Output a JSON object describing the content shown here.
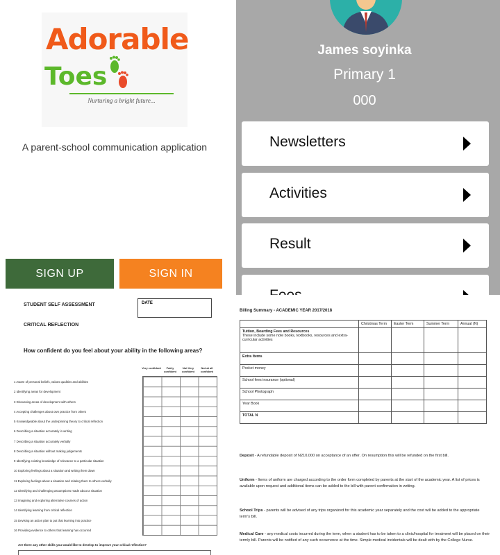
{
  "landing": {
    "logo_line1": "Adorable",
    "logo_line2": "Toes",
    "logo_tagline": "Nurturing a bright future...",
    "description": "A parent-school communication application",
    "signup_label": "SIGN UP",
    "signin_label": "SIGN IN",
    "colors": {
      "orange": "#f05a1a",
      "green": "#5cb82b",
      "signup_bg": "#3e6a3a",
      "signin_bg": "#f58220"
    }
  },
  "profile": {
    "name": "James soyinka",
    "class": "Primary 1",
    "id": "000",
    "menu": [
      "Newsletters",
      "Activities",
      "Result",
      "Fees"
    ],
    "colors": {
      "background": "#a8a8a8",
      "avatar_bg": "#2cb0a8"
    }
  },
  "assessment": {
    "title": "STUDENT SELF ASSESSMENT",
    "date_label": "DATE",
    "section": "CRITICAL REFLECTION",
    "question": "How confident do you feel about your ability in the following areas?",
    "columns": [
      "Very confident",
      "Fairly confident",
      "Not Very confident",
      "Not at all confident"
    ],
    "items": [
      "1  Aware of personal beliefs, values qualities and abilities",
      "2  Identifying areas for development",
      "3  Discussing areas of development with others",
      "4  Accepting challenges about own practice from others",
      "5  Knowledgeable about the underpinning theory to critical reflection",
      "6  Describing a situation accurately in writing",
      "7  Describing a situation accurately verbally",
      "8  Describing a situation without making judgements",
      "9  Identifying existing knowledge of relevance to a particular situation",
      "10 Exploring feelings about a situation and writing them down",
      "11 Exploring feelings about a situation and relating them to others verbally",
      "12 Identifying and challenging assumptions made about a situation",
      "13 Imagining and exploring alternative courses of action",
      "14 Identifying learning from critical reflection",
      "15 Devising an action plan to put that learning into practice",
      "16 Providing evidence to others that learning has occurred"
    ],
    "footer_question": "Are there any other skills you would like to develop to improve your critical reflection?"
  },
  "billing": {
    "title": "Billing Summary - ACADEMIC YEAR 2017/2018",
    "headers": [
      "Christmas Term",
      "Easter Term",
      "Summer Term",
      "Annual (N)"
    ],
    "rows": [
      "Tuition, Boarding Fees and Resources",
      "Extra Items",
      "Pocket money",
      "School fees insurance (optional)",
      "School Photograph",
      "Year Book",
      "TOTAL N"
    ],
    "tuition_note": "These include some note books, textbooks, resources and extra-curricular activities",
    "deposit_label": "Deposit",
    "deposit_text": " - A refundable deposit of N210,000 on acceptance of an offer. On resumption this will be refunded on the first bill.",
    "uniform_label": "Uniform",
    "uniform_text": " - Items of uniform are charged according to the order form completed by parents at the start of the academic year. A list of prices is available upon request and additional items can be added to the bill with parent confirmation in writing.",
    "trips_label": "School Trips",
    "trips_text": " - parents will be advised of any trips organized for this academic year separately and the cost will be added to the appropriate term's bill.",
    "medical_label": "Medical Care",
    "medical_text": " - any medical costs incurred during the term, when a student has to be taken to a clinic/hospital for treatment will be placed on their termly bill. Parents will be notified of any such occurrence at the time. Simple medical incidentals will be dealt with by the College Nurse."
  }
}
